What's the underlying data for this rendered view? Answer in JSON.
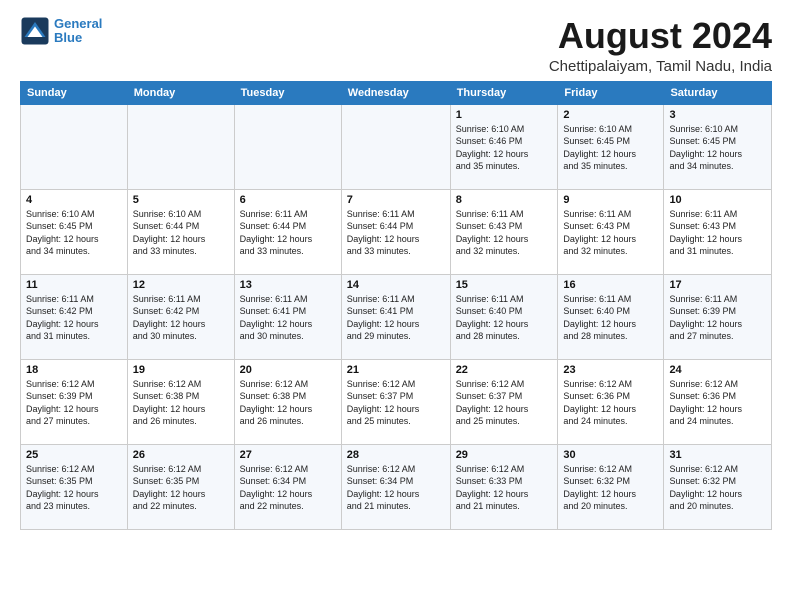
{
  "logo": {
    "line1": "General",
    "line2": "Blue"
  },
  "title": "August 2024",
  "subtitle": "Chettipalaiyam, Tamil Nadu, India",
  "weekdays": [
    "Sunday",
    "Monday",
    "Tuesday",
    "Wednesday",
    "Thursday",
    "Friday",
    "Saturday"
  ],
  "weeks": [
    [
      {
        "day": "",
        "info": ""
      },
      {
        "day": "",
        "info": ""
      },
      {
        "day": "",
        "info": ""
      },
      {
        "day": "",
        "info": ""
      },
      {
        "day": "1",
        "info": "Sunrise: 6:10 AM\nSunset: 6:46 PM\nDaylight: 12 hours\nand 35 minutes."
      },
      {
        "day": "2",
        "info": "Sunrise: 6:10 AM\nSunset: 6:45 PM\nDaylight: 12 hours\nand 35 minutes."
      },
      {
        "day": "3",
        "info": "Sunrise: 6:10 AM\nSunset: 6:45 PM\nDaylight: 12 hours\nand 34 minutes."
      }
    ],
    [
      {
        "day": "4",
        "info": "Sunrise: 6:10 AM\nSunset: 6:45 PM\nDaylight: 12 hours\nand 34 minutes."
      },
      {
        "day": "5",
        "info": "Sunrise: 6:10 AM\nSunset: 6:44 PM\nDaylight: 12 hours\nand 33 minutes."
      },
      {
        "day": "6",
        "info": "Sunrise: 6:11 AM\nSunset: 6:44 PM\nDaylight: 12 hours\nand 33 minutes."
      },
      {
        "day": "7",
        "info": "Sunrise: 6:11 AM\nSunset: 6:44 PM\nDaylight: 12 hours\nand 33 minutes."
      },
      {
        "day": "8",
        "info": "Sunrise: 6:11 AM\nSunset: 6:43 PM\nDaylight: 12 hours\nand 32 minutes."
      },
      {
        "day": "9",
        "info": "Sunrise: 6:11 AM\nSunset: 6:43 PM\nDaylight: 12 hours\nand 32 minutes."
      },
      {
        "day": "10",
        "info": "Sunrise: 6:11 AM\nSunset: 6:43 PM\nDaylight: 12 hours\nand 31 minutes."
      }
    ],
    [
      {
        "day": "11",
        "info": "Sunrise: 6:11 AM\nSunset: 6:42 PM\nDaylight: 12 hours\nand 31 minutes."
      },
      {
        "day": "12",
        "info": "Sunrise: 6:11 AM\nSunset: 6:42 PM\nDaylight: 12 hours\nand 30 minutes."
      },
      {
        "day": "13",
        "info": "Sunrise: 6:11 AM\nSunset: 6:41 PM\nDaylight: 12 hours\nand 30 minutes."
      },
      {
        "day": "14",
        "info": "Sunrise: 6:11 AM\nSunset: 6:41 PM\nDaylight: 12 hours\nand 29 minutes."
      },
      {
        "day": "15",
        "info": "Sunrise: 6:11 AM\nSunset: 6:40 PM\nDaylight: 12 hours\nand 28 minutes."
      },
      {
        "day": "16",
        "info": "Sunrise: 6:11 AM\nSunset: 6:40 PM\nDaylight: 12 hours\nand 28 minutes."
      },
      {
        "day": "17",
        "info": "Sunrise: 6:11 AM\nSunset: 6:39 PM\nDaylight: 12 hours\nand 27 minutes."
      }
    ],
    [
      {
        "day": "18",
        "info": "Sunrise: 6:12 AM\nSunset: 6:39 PM\nDaylight: 12 hours\nand 27 minutes."
      },
      {
        "day": "19",
        "info": "Sunrise: 6:12 AM\nSunset: 6:38 PM\nDaylight: 12 hours\nand 26 minutes."
      },
      {
        "day": "20",
        "info": "Sunrise: 6:12 AM\nSunset: 6:38 PM\nDaylight: 12 hours\nand 26 minutes."
      },
      {
        "day": "21",
        "info": "Sunrise: 6:12 AM\nSunset: 6:37 PM\nDaylight: 12 hours\nand 25 minutes."
      },
      {
        "day": "22",
        "info": "Sunrise: 6:12 AM\nSunset: 6:37 PM\nDaylight: 12 hours\nand 25 minutes."
      },
      {
        "day": "23",
        "info": "Sunrise: 6:12 AM\nSunset: 6:36 PM\nDaylight: 12 hours\nand 24 minutes."
      },
      {
        "day": "24",
        "info": "Sunrise: 6:12 AM\nSunset: 6:36 PM\nDaylight: 12 hours\nand 24 minutes."
      }
    ],
    [
      {
        "day": "25",
        "info": "Sunrise: 6:12 AM\nSunset: 6:35 PM\nDaylight: 12 hours\nand 23 minutes."
      },
      {
        "day": "26",
        "info": "Sunrise: 6:12 AM\nSunset: 6:35 PM\nDaylight: 12 hours\nand 22 minutes."
      },
      {
        "day": "27",
        "info": "Sunrise: 6:12 AM\nSunset: 6:34 PM\nDaylight: 12 hours\nand 22 minutes."
      },
      {
        "day": "28",
        "info": "Sunrise: 6:12 AM\nSunset: 6:34 PM\nDaylight: 12 hours\nand 21 minutes."
      },
      {
        "day": "29",
        "info": "Sunrise: 6:12 AM\nSunset: 6:33 PM\nDaylight: 12 hours\nand 21 minutes."
      },
      {
        "day": "30",
        "info": "Sunrise: 6:12 AM\nSunset: 6:32 PM\nDaylight: 12 hours\nand 20 minutes."
      },
      {
        "day": "31",
        "info": "Sunrise: 6:12 AM\nSunset: 6:32 PM\nDaylight: 12 hours\nand 20 minutes."
      }
    ]
  ]
}
